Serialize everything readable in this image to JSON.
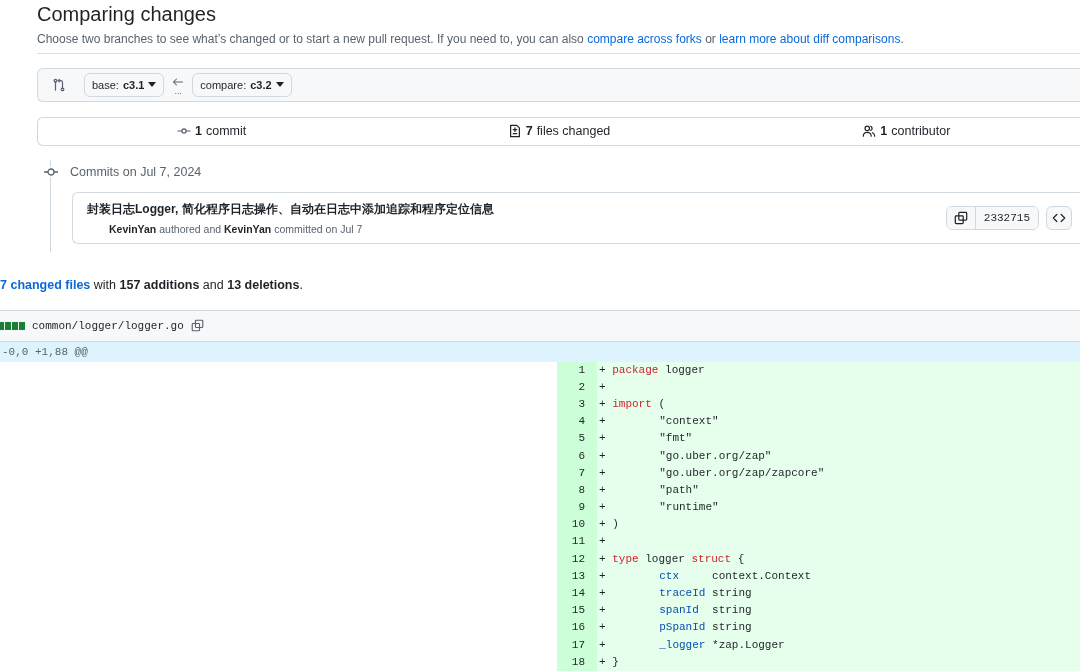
{
  "header": {
    "title": "Comparing changes",
    "description": [
      {
        "kind": "text",
        "text": "Choose two branches to see what’s changed or to start a new pull request. If you need to, you can also "
      },
      {
        "kind": "link",
        "text": "compare across forks"
      },
      {
        "kind": "text",
        "text": " or "
      },
      {
        "kind": "link",
        "text": "learn more about diff comparisons"
      },
      {
        "kind": "text",
        "text": "."
      }
    ]
  },
  "range": {
    "base": {
      "label": "base:",
      "branch": "c3.1"
    },
    "compare": {
      "label": "compare:",
      "branch": "c3.2"
    },
    "dots": "..."
  },
  "stats": [
    {
      "kind": "commit",
      "count": "1",
      "label": "commit"
    },
    {
      "kind": "files",
      "count": "7",
      "label": "files changed"
    },
    {
      "kind": "people",
      "count": "1",
      "label": "contributor"
    }
  ],
  "commit_group": {
    "date_label": "Commits on Jul 7, 2024",
    "commits": [
      {
        "message": "封装日志Logger, 简化程序日志操作、自动在日志中添加追踪和程序定位信息",
        "author": "KevinYan",
        "authored_text": "authored and",
        "committer": "KevinYan",
        "committed_text": "committed on Jul 7",
        "sha": "2332715"
      }
    ]
  },
  "summary": [
    {
      "kind": "link",
      "text": "7 changed files"
    },
    {
      "kind": "text",
      "text": " with "
    },
    {
      "kind": "bold",
      "text": "157 additions"
    },
    {
      "kind": "text",
      "text": " and "
    },
    {
      "kind": "bold",
      "text": "13 deletions"
    },
    {
      "kind": "text",
      "text": "."
    }
  ],
  "file": {
    "path": "common/logger/logger.go",
    "hunk": "-0,0 +1,88 @@",
    "lines": [
      {
        "number": "1",
        "sign": "+",
        "indented": false,
        "tokens": [
          {
            "kind": "keyword",
            "text": "package"
          },
          {
            "kind": "plain",
            "text": " logger"
          }
        ]
      },
      {
        "number": "2",
        "sign": "+"
      },
      {
        "number": "3",
        "sign": "+",
        "indented": false,
        "tokens": [
          {
            "kind": "keyword",
            "text": "import"
          },
          {
            "kind": "plain",
            "text": " ("
          }
        ]
      },
      {
        "number": "4",
        "sign": "+",
        "indented": true,
        "tokens": [
          {
            "kind": "plain",
            "text": "\"context\""
          }
        ]
      },
      {
        "number": "5",
        "sign": "+",
        "indented": true,
        "tokens": [
          {
            "kind": "plain",
            "text": "\"fmt\""
          }
        ]
      },
      {
        "number": "6",
        "sign": "+",
        "indented": true,
        "tokens": [
          {
            "kind": "plain",
            "text": "\"go.uber.org/zap\""
          }
        ]
      },
      {
        "number": "7",
        "sign": "+",
        "indented": true,
        "tokens": [
          {
            "kind": "plain",
            "text": "\"go.uber.org/zap/zapcore\""
          }
        ]
      },
      {
        "number": "8",
        "sign": "+",
        "indented": true,
        "tokens": [
          {
            "kind": "plain",
            "text": "\"path\""
          }
        ]
      },
      {
        "number": "9",
        "sign": "+",
        "indented": true,
        "tokens": [
          {
            "kind": "plain",
            "text": "\"runtime\""
          }
        ]
      },
      {
        "number": "10",
        "sign": "+",
        "indented": false,
        "tokens": [
          {
            "kind": "plain",
            "text": ")"
          }
        ]
      },
      {
        "number": "11",
        "sign": "+"
      },
      {
        "number": "12",
        "sign": "+",
        "indented": false,
        "tokens": [
          {
            "kind": "keyword",
            "text": "type"
          },
          {
            "kind": "plain",
            "text": " logger "
          },
          {
            "kind": "keyword",
            "text": "struct"
          },
          {
            "kind": "plain",
            "text": " {"
          }
        ]
      },
      {
        "number": "13",
        "sign": "+",
        "indented": true,
        "tokens": [
          {
            "kind": "ident",
            "text": "ctx"
          },
          {
            "kind": "plain",
            "text": "     context.Context"
          }
        ]
      },
      {
        "number": "14",
        "sign": "+",
        "indented": true,
        "tokens": [
          {
            "kind": "ident",
            "text": "traceId"
          },
          {
            "kind": "plain",
            "text": " string"
          }
        ]
      },
      {
        "number": "15",
        "sign": "+",
        "indented": true,
        "tokens": [
          {
            "kind": "ident",
            "text": "spanId"
          },
          {
            "kind": "plain",
            "text": "  string"
          }
        ]
      },
      {
        "number": "16",
        "sign": "+",
        "indented": true,
        "tokens": [
          {
            "kind": "ident",
            "text": "pSpanId"
          },
          {
            "kind": "plain",
            "text": " string"
          }
        ]
      },
      {
        "number": "17",
        "sign": "+",
        "indented": true,
        "tokens": [
          {
            "kind": "ident",
            "text": "_logger"
          },
          {
            "kind": "plain",
            "text": " *zap.Logger"
          }
        ]
      },
      {
        "number": "18",
        "sign": "+",
        "indented": false,
        "tokens": [
          {
            "kind": "plain",
            "text": "}"
          }
        ]
      }
    ]
  }
}
